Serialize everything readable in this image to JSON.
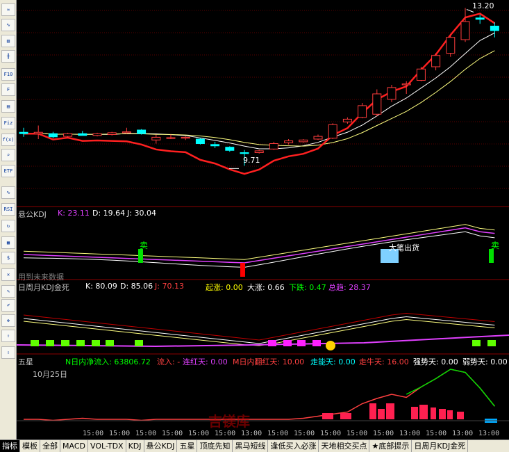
{
  "toolbar": {
    "buttons": [
      "chart-curve",
      "chart-line",
      "chart-bars",
      "chart-candle",
      "F10",
      "finance",
      "F10-info",
      "Fiz",
      "fx",
      "search",
      "ETF",
      "indicator-wave",
      "RSI",
      "refresh",
      "calc",
      "money",
      "remove",
      "settings",
      "pencil",
      "move",
      "arrow-up",
      "arrow-down"
    ]
  },
  "main": {
    "high_label": "13.20",
    "low_label": "9.71",
    "colors": {
      "up": "#ff3c3c",
      "down": "#00ffff",
      "ma1": "#ffffff",
      "ma2": "#ffff80",
      "band": "#ff2020"
    }
  },
  "panel_kdj": {
    "title": "悬公KDJ",
    "k_label": "K: 23.11",
    "d_label": "D: 19.64",
    "j_label": "J: 30.04",
    "sell1": "卖",
    "sell2": "卖",
    "note": "用到未来数据",
    "bigsell": "大笔出货"
  },
  "panel_kdj2": {
    "title": "日周月KDJ金死",
    "k_label": "K: 80.09",
    "d_label": "D: 85.06",
    "j_label": "J: 70.13",
    "qz_label": "起涨: 0.00",
    "dz_label": "大涨: 0.66",
    "xd_label": "下跌: 0.47",
    "zq_label": "总趋: 28.37"
  },
  "panel_star": {
    "title": "五星",
    "n_label": "N日内净流入: 63806.72",
    "liuru_label": "流入: -",
    "lhong_label": "连红天: 0.00",
    "mfan_label": "M日内翻红天: 10.00",
    "zoneng_label": "走能天: 0.00",
    "zouniu_label": "走牛天: 16.00",
    "qiang_label": "强势天: 0.00",
    "ruo_label": "弱势天: 0.00",
    "date_label": "10月25日",
    "time_ticks": [
      "15:00",
      "15:00",
      "15:00",
      "15:00",
      "15:00",
      "15:00",
      "13:00",
      "15:00",
      "15:00",
      "15:00",
      "15:00",
      "15:00",
      "13:00",
      "15:00",
      "13:00",
      "13:00"
    ]
  },
  "watermark": "吉镁库",
  "tabs": [
    "指标",
    "模板",
    "全部",
    "MACD",
    "VOL-TDX",
    "KDJ",
    "悬公KDJ",
    "五星",
    "顶底先知",
    "黑马短线",
    "逢低买入必涨",
    "天地相交买点",
    "★底部提示",
    "日周月KDJ金死"
  ],
  "chart_data": {
    "type": "candlestick",
    "n_bars": 32,
    "candles": [
      {
        "o": 10.45,
        "h": 10.55,
        "l": 10.35,
        "c": 10.42
      },
      {
        "o": 10.42,
        "h": 10.6,
        "l": 10.3,
        "c": 10.45
      },
      {
        "o": 10.42,
        "h": 10.46,
        "l": 10.32,
        "c": 10.35
      },
      {
        "o": 10.36,
        "h": 10.44,
        "l": 10.33,
        "c": 10.42
      },
      {
        "o": 10.42,
        "h": 10.48,
        "l": 10.38,
        "c": 10.38
      },
      {
        "o": 10.38,
        "h": 10.44,
        "l": 10.36,
        "c": 10.42
      },
      {
        "o": 10.4,
        "h": 10.46,
        "l": 10.38,
        "c": 10.44
      },
      {
        "o": 10.44,
        "h": 10.55,
        "l": 10.42,
        "c": 10.46
      },
      {
        "o": 10.5,
        "h": 10.52,
        "l": 10.4,
        "c": 10.42
      },
      {
        "o": 10.28,
        "h": 10.4,
        "l": 10.2,
        "c": 10.34
      },
      {
        "o": 10.32,
        "h": 10.4,
        "l": 10.3,
        "c": 10.33
      },
      {
        "o": 10.32,
        "h": 10.36,
        "l": 10.28,
        "c": 10.34
      },
      {
        "o": 10.3,
        "h": 10.32,
        "l": 10.18,
        "c": 10.2
      },
      {
        "o": 10.18,
        "h": 10.24,
        "l": 10.1,
        "c": 10.15
      },
      {
        "o": 10.12,
        "h": 10.14,
        "l": 10.02,
        "c": 10.05
      },
      {
        "o": 10.0,
        "h": 10.06,
        "l": 9.71,
        "c": 9.98
      },
      {
        "o": 10.0,
        "h": 10.06,
        "l": 9.98,
        "c": 10.04
      },
      {
        "o": 10.08,
        "h": 10.24,
        "l": 10.06,
        "c": 10.2
      },
      {
        "o": 10.22,
        "h": 10.3,
        "l": 10.18,
        "c": 10.26
      },
      {
        "o": 10.24,
        "h": 10.3,
        "l": 10.22,
        "c": 10.28
      },
      {
        "o": 10.3,
        "h": 10.4,
        "l": 10.28,
        "c": 10.36
      },
      {
        "o": 10.32,
        "h": 10.65,
        "l": 10.3,
        "c": 10.62
      },
      {
        "o": 10.68,
        "h": 10.78,
        "l": 10.64,
        "c": 10.74
      },
      {
        "o": 10.78,
        "h": 11.1,
        "l": 10.76,
        "c": 11.04
      },
      {
        "o": 10.85,
        "h": 11.4,
        "l": 10.8,
        "c": 11.3
      },
      {
        "o": 11.18,
        "h": 11.5,
        "l": 11.12,
        "c": 11.44
      },
      {
        "o": 11.5,
        "h": 11.58,
        "l": 11.3,
        "c": 11.52
      },
      {
        "o": 11.6,
        "h": 11.9,
        "l": 11.58,
        "c": 11.85
      },
      {
        "o": 11.9,
        "h": 12.2,
        "l": 11.82,
        "c": 12.15
      },
      {
        "o": 12.2,
        "h": 12.6,
        "l": 12.12,
        "c": 12.55
      },
      {
        "o": 12.5,
        "h": 13.2,
        "l": 12.45,
        "c": 12.9
      },
      {
        "o": 12.98,
        "h": 13.05,
        "l": 12.85,
        "c": 12.95
      },
      {
        "o": 12.8,
        "h": 12.88,
        "l": 12.55,
        "c": 12.7
      }
    ],
    "ylim": [
      9.3,
      13.3
    ],
    "high": 13.2,
    "low": 9.71
  }
}
